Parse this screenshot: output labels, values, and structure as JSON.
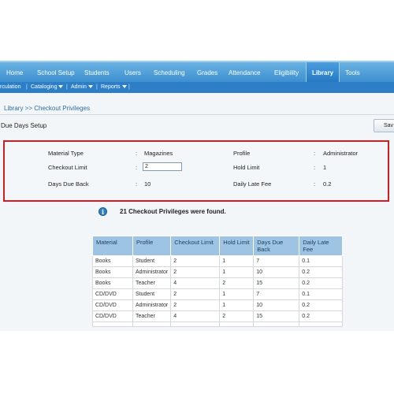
{
  "top_nav": {
    "tabs": [
      {
        "label": "Home"
      },
      {
        "label": "School Setup"
      },
      {
        "label": "Students"
      },
      {
        "label": "Users"
      },
      {
        "label": "Scheduling"
      },
      {
        "label": "Grades"
      },
      {
        "label": "Attendance"
      },
      {
        "label": "Eligibility"
      },
      {
        "label": "Library"
      },
      {
        "label": "Tools"
      }
    ],
    "active_tab": "Library"
  },
  "sub_nav": {
    "items": [
      {
        "label": "rculation"
      },
      {
        "label": "Cataloging"
      },
      {
        "label": "Admin"
      },
      {
        "label": "Reports"
      }
    ],
    "separator": "|"
  },
  "breadcrumb": "Library >> Checkout Privileges",
  "section_title": "Due Days Setup",
  "save_button": "Sav",
  "setup": {
    "colon": ":",
    "material_type": {
      "label": "Material Type",
      "value": "Magazines"
    },
    "profile": {
      "label": "Profile",
      "value": "Administrator"
    },
    "checkout_limit": {
      "label": "Checkout Limit",
      "value": "2"
    },
    "hold_limit": {
      "label": "Hold Limit",
      "value": "1"
    },
    "days_due_back": {
      "label": "Days Due Back",
      "value": "10"
    },
    "daily_late_fee": {
      "label": "Daily Late Fee",
      "value": "0.2"
    }
  },
  "results_message": "21 Checkout Privileges were found.",
  "info_icon_glyph": "i",
  "table": {
    "headers": [
      "Material",
      "Profile",
      "Checkout Limit",
      "Hold Limit",
      "Days Due Back",
      "Daily Late Fee"
    ],
    "rows": [
      [
        "Books",
        "Student",
        "2",
        "1",
        "7",
        "0.1"
      ],
      [
        "Books",
        "Administrator",
        "2",
        "1",
        "10",
        "0.2"
      ],
      [
        "Books",
        "Teacher",
        "4",
        "2",
        "15",
        "0.2"
      ],
      [
        "CD/DVD",
        "Student",
        "2",
        "1",
        "7",
        "0.1"
      ],
      [
        "CD/DVD",
        "Administrator",
        "2",
        "1",
        "10",
        "0.2"
      ],
      [
        "CD/DVD",
        "Teacher",
        "4",
        "2",
        "15",
        "0.2"
      ]
    ]
  },
  "colors": {
    "nav_blue": "#3d8fd0",
    "subnav_blue": "#2c7fc6",
    "highlight_red": "#cf1f25",
    "table_header": "#9dc4e2"
  }
}
